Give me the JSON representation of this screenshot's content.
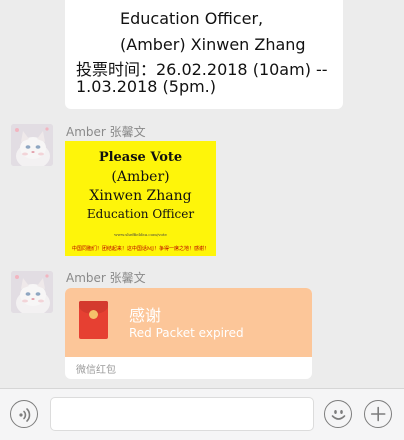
{
  "messages": {
    "top_card": {
      "line1": "Education Officer,",
      "line2": "(Amber) Xinwen Zhang",
      "line3": "投票时间：26.02.2018 (10am) --",
      "line4": "1.03.2018 (5pm.)"
    },
    "poster_message": {
      "sender": "Amber 张馨文",
      "poster": {
        "line1": "Please Vote",
        "line2": "(Amber)",
        "line3": "Xinwen Zhang",
        "line4": "Education Officer",
        "url": "www.sheffieldsu.com/vote",
        "footer": "中国同胞们！团结起来！这中国话MJ！争得一席之地！感谢！"
      }
    },
    "packet_message": {
      "sender": "Amber 张馨文",
      "packet_title": "感谢",
      "packet_status": "Red Packet expired",
      "packet_footer": "微信红包"
    }
  },
  "input_bar": {
    "voice_icon": "voice-icon",
    "emoji_icon": "emoji-icon",
    "plus_icon": "plus-icon"
  },
  "colors": {
    "chat_background": "#ececec",
    "poster_yellow": "#fef50a",
    "packet_orange": "#fcc699",
    "envelope_red": "#e64032"
  }
}
